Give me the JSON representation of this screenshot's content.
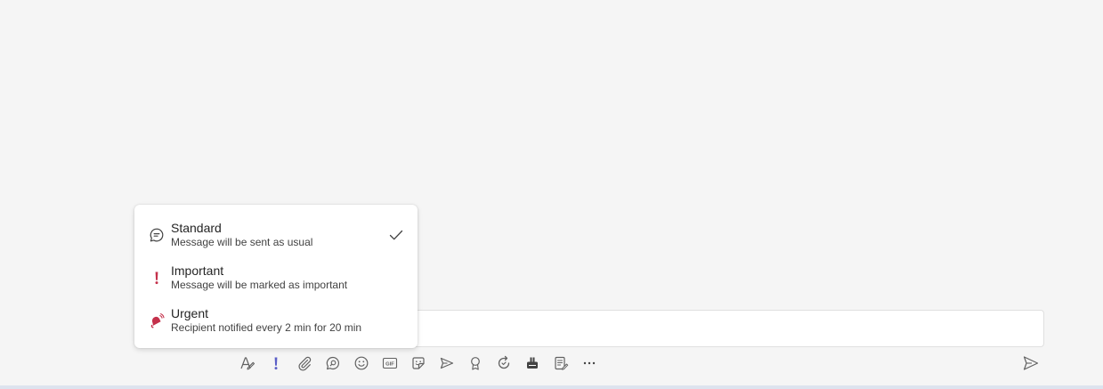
{
  "priority_menu": {
    "items": [
      {
        "label": "Standard",
        "description": "Message will be sent as usual",
        "icon": "chat-bubble-icon",
        "selected": true
      },
      {
        "label": "Important",
        "description": "Message will be marked as important",
        "icon": "exclamation-icon",
        "selected": false
      },
      {
        "label": "Urgent",
        "description": "Recipient notified every 2 min for 20 min",
        "icon": "alert-bell-icon",
        "selected": false
      }
    ]
  },
  "toolbar": {
    "buttons": [
      {
        "name": "format-icon"
      },
      {
        "name": "priority-icon"
      },
      {
        "name": "attach-icon"
      },
      {
        "name": "loop-component-icon"
      },
      {
        "name": "emoji-icon"
      },
      {
        "name": "gif-icon",
        "text": "GIF"
      },
      {
        "name": "sticker-icon"
      },
      {
        "name": "schedule-meeting-icon"
      },
      {
        "name": "praise-icon"
      },
      {
        "name": "updates-icon"
      },
      {
        "name": "approvals-icon"
      },
      {
        "name": "forms-icon"
      },
      {
        "name": "more-options-icon"
      }
    ],
    "send_icon": "send-icon"
  },
  "colors": {
    "background": "#f5f5f5",
    "accent": "#5b5fc7",
    "important_red": "#c4314b",
    "icon_gray": "#616161"
  }
}
